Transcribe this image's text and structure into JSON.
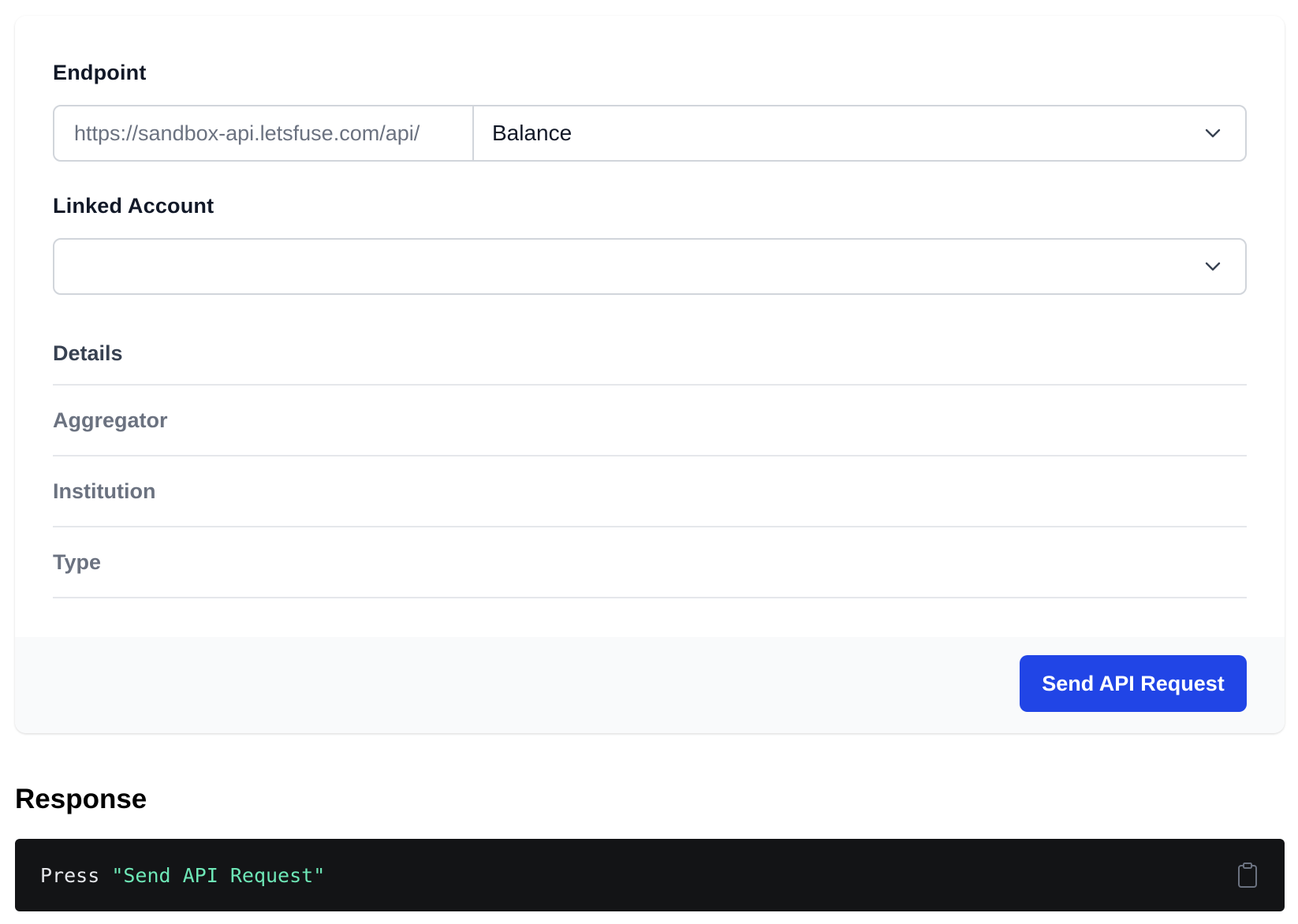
{
  "form": {
    "endpoint_label": "Endpoint",
    "endpoint_prefix": "https://sandbox-api.letsfuse.com/api/",
    "endpoint_selected": "Balance",
    "linked_account_label": "Linked Account",
    "linked_account_value": "",
    "details_title": "Details",
    "details_rows": [
      "Aggregator",
      "Institution",
      "Type"
    ],
    "send_button_label": "Send API Request"
  },
  "response": {
    "title": "Response",
    "code_keyword": "Press",
    "code_string": "\"Send API Request\""
  },
  "colors": {
    "primary_button": "#2145e6",
    "code_background": "#131416",
    "code_string": "#6ee7b7"
  },
  "icons": {
    "endpoint_select": "chevron-down-icon",
    "linked_account_select": "chevron-down-icon",
    "copy": "clipboard-icon"
  }
}
